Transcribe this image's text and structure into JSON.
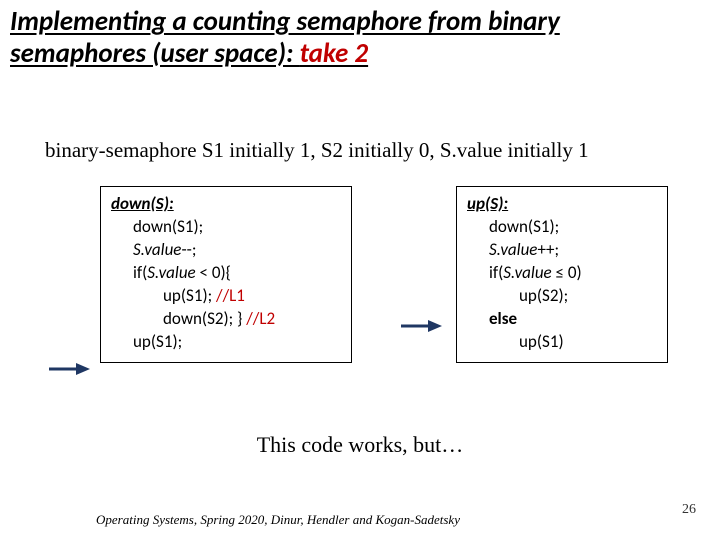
{
  "title": {
    "main": "Implementing a counting semaphore from binary semaphores (user space): ",
    "take2": "take 2"
  },
  "init_line": "binary-semaphore S1 initially 1, S2 initially 0,  S.value initially 1",
  "down": {
    "fn": "down(S):",
    "l1": "down(S1);",
    "l2a": "S.value",
    "l2b": "--;",
    "l3a": "if(",
    "l3b": "S.value",
    "l3c": " < 0){",
    "l4a": "up(S1);  ",
    "l4b": "//L1",
    "l5a": "down(S2); } ",
    "l5b": "//L2",
    "l6": "up(S1);"
  },
  "up": {
    "fn": "up(S):",
    "l1": "down(S1);",
    "l2a": "S.value",
    "l2b": "++;",
    "l3a": "if(",
    "l3b": "S.value",
    "l3c": " ≤ 0)",
    "l4": "up(S2);",
    "l5": "else",
    "l6": "up(S1)"
  },
  "caption": "This code works, but…",
  "footer": "Operating Systems,  Spring 2020, Dinur, Hendler and Kogan-Sadetsky",
  "page": "26"
}
